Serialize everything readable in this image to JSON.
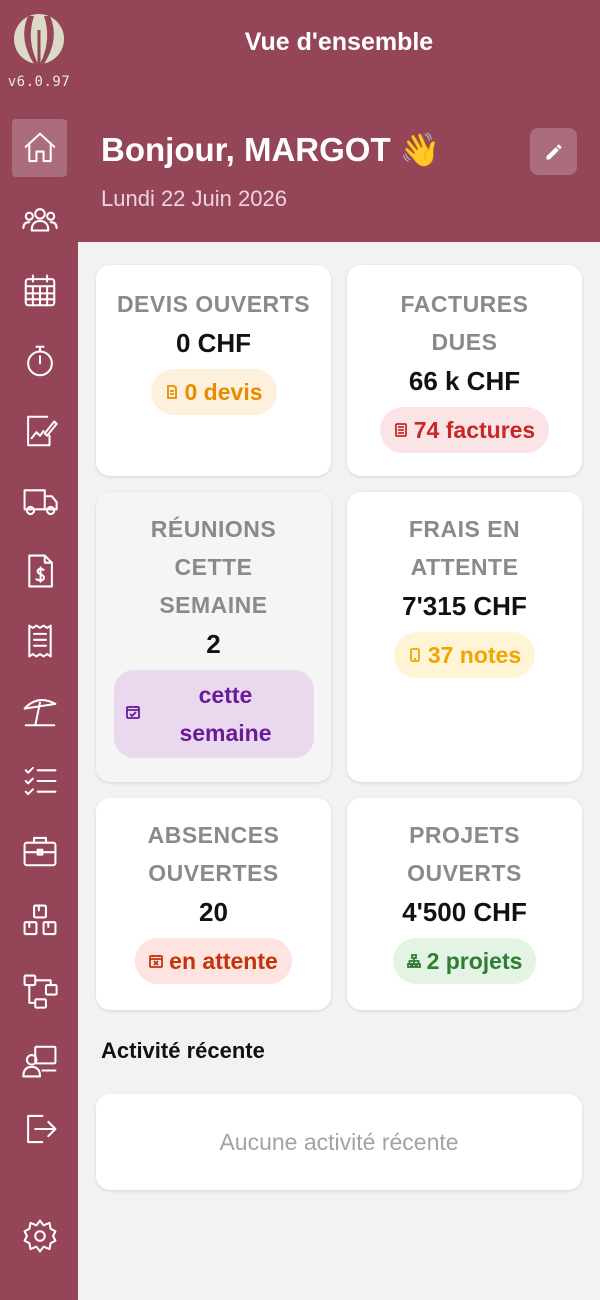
{
  "app": {
    "version": "v6.0.97",
    "title": "Vue d'ensemble"
  },
  "header": {
    "greeting": "Bonjour, MARGOT",
    "greeting_emoji": "👋",
    "date": "Lundi 22 Juin 2026"
  },
  "sidebar": {
    "items": [
      {
        "icon": "home-icon",
        "active": true
      },
      {
        "icon": "users-icon"
      },
      {
        "icon": "calendar-icon"
      },
      {
        "icon": "stopwatch-icon"
      },
      {
        "icon": "signature-chart-icon"
      },
      {
        "icon": "truck-icon"
      },
      {
        "icon": "invoice-dollar-icon"
      },
      {
        "icon": "receipt-icon"
      },
      {
        "icon": "beach-umbrella-icon"
      },
      {
        "icon": "checklist-icon"
      },
      {
        "icon": "briefcase-icon"
      },
      {
        "icon": "boxes-icon"
      },
      {
        "icon": "hierarchy-icon"
      },
      {
        "icon": "user-screen-icon"
      },
      {
        "icon": "logout-icon"
      },
      {
        "icon": "gear-icon"
      }
    ]
  },
  "cards": {
    "devis": {
      "label": "DEVIS OUVERTS",
      "value": "0 CHF",
      "badge": "0 devis",
      "badge_icon": "document-icon"
    },
    "factures": {
      "label_1": "FACTURES",
      "label_2": "DUES",
      "value": "66 k CHF",
      "badge": "74 factures",
      "badge_icon": "list-doc-icon"
    },
    "reunions": {
      "label_1": "RÉUNIONS",
      "label_2": "CETTE",
      "label_3": "SEMAINE",
      "value": "2",
      "badge_1": "cette",
      "badge_2": "semaine",
      "badge_icon": "calendar-check-icon"
    },
    "frais": {
      "label_1": "FRAIS EN",
      "label_2": "ATTENTE",
      "value": "7'315 CHF",
      "badge": "37 notes",
      "badge_icon": "mobile-icon"
    },
    "absences": {
      "label_1": "ABSENCES",
      "label_2": "OUVERTES",
      "value": "20",
      "badge": "en attente",
      "badge_icon": "calendar-x-icon"
    },
    "projets": {
      "label_1": "PROJETS",
      "label_2": "OUVERTS",
      "value": "4'500 CHF",
      "badge": "2 projets",
      "badge_icon": "sitemap-icon"
    }
  },
  "activity": {
    "title": "Activité récente",
    "empty": "Aucune activité récente"
  },
  "colors": {
    "brand": "#944557",
    "background": "#f2f2f2"
  }
}
